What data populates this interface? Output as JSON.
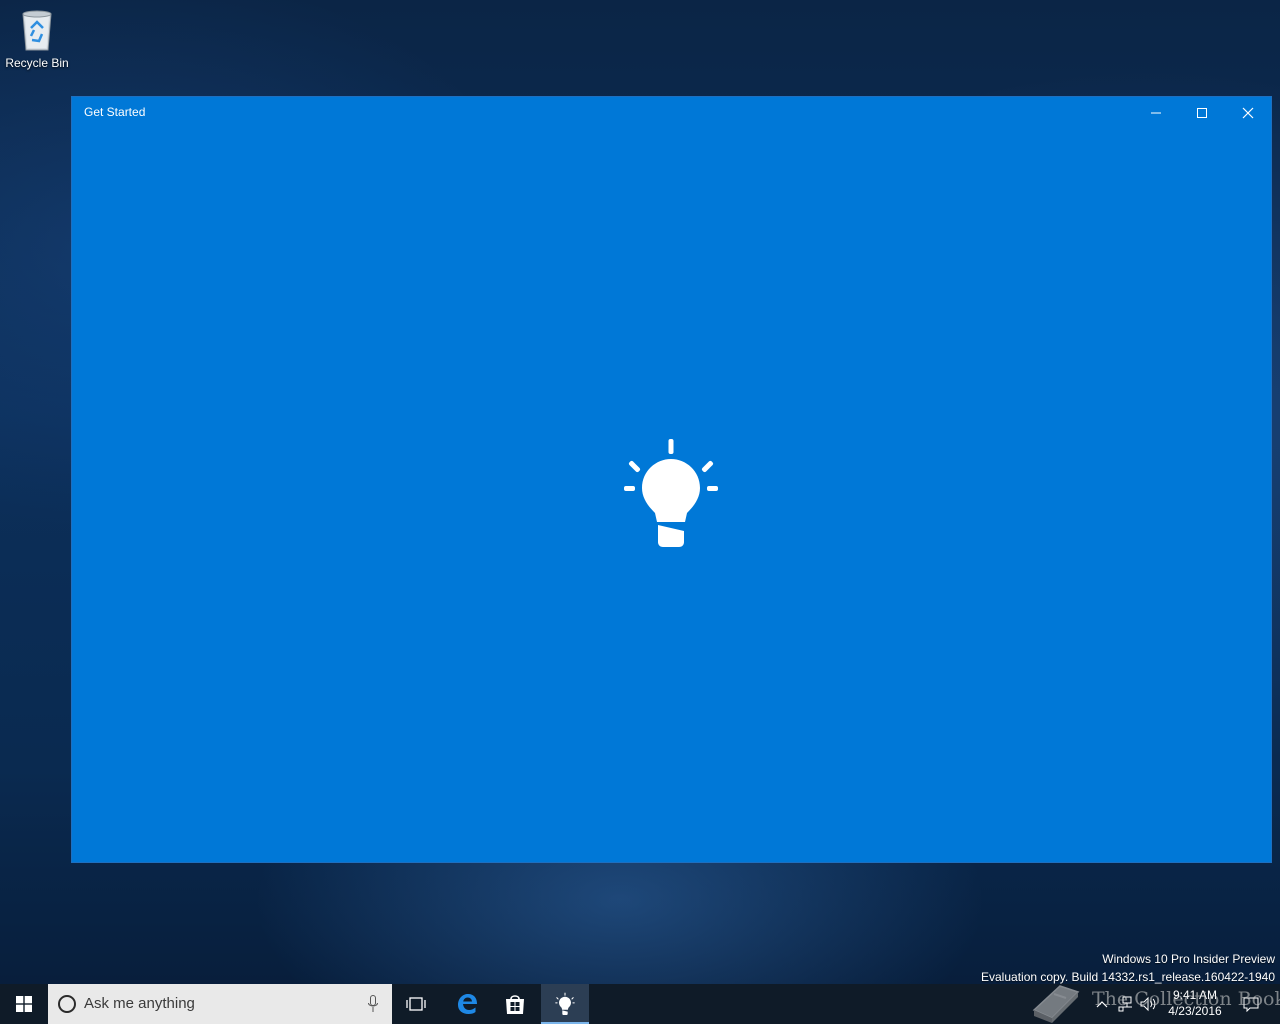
{
  "desktop": {
    "icons": [
      {
        "label": "Recycle Bin",
        "icon": "recycle-bin-icon"
      }
    ],
    "watermark": {
      "line1": "Windows 10 Pro Insider Preview",
      "line2": "Evaluation copy. Build 14332.rs1_release.160422-1940"
    },
    "overlay_brand": "The Collection Book"
  },
  "window": {
    "title": "Get Started",
    "controls": [
      "minimize-icon",
      "maximize-icon",
      "close-icon"
    ],
    "splash_icon": "lightbulb-icon",
    "background_color": "#0078d7"
  },
  "taskbar": {
    "search_placeholder": "Ask me anything",
    "pinned": [
      "task-view-icon",
      "edge-icon",
      "store-icon",
      "get-started-icon"
    ],
    "active_app": "Get Started",
    "clock": {
      "time": "9:41 AM",
      "date": "4/23/2016"
    },
    "accent_color": "#7ab4ea"
  }
}
